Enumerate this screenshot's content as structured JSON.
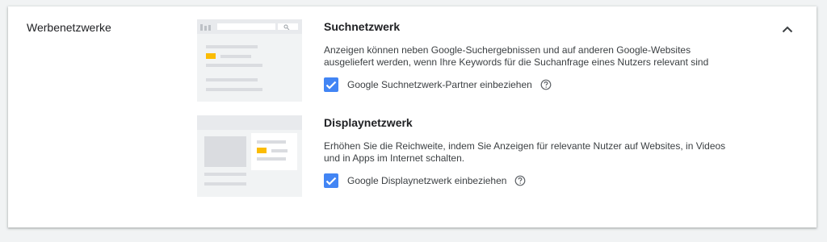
{
  "section": {
    "title": "Werbenetzwerke",
    "collapse_icon": "chevron-up-icon"
  },
  "search_network": {
    "title": "Suchnetzwerk",
    "description_line1": "Anzeigen können neben Google-Suchergebnissen und auf anderen Google-Websites",
    "description_line2": "ausgeliefert werden, wenn Ihre Keywords für die Suchanfrage eines Nutzers relevant sind",
    "checkbox_label": "Google Suchnetzwerk-Partner einbeziehen",
    "checked": true,
    "help_icon": "help-circle-icon"
  },
  "display_network": {
    "title": "Displaynetzwerk",
    "description_line1": "Erhöhen Sie die Reichweite, indem Sie Anzeigen für relevante Nutzer auf Websites, in Videos",
    "description_line2": "und in Apps im Internet schalten.",
    "checkbox_label": "Google Displaynetzwerk einbeziehen",
    "checked": true,
    "help_icon": "help-circle-icon"
  },
  "colors": {
    "checkbox": "#4285f4",
    "accent_yellow": "#fbbc04",
    "illustration_bg": "#f1f3f4"
  }
}
